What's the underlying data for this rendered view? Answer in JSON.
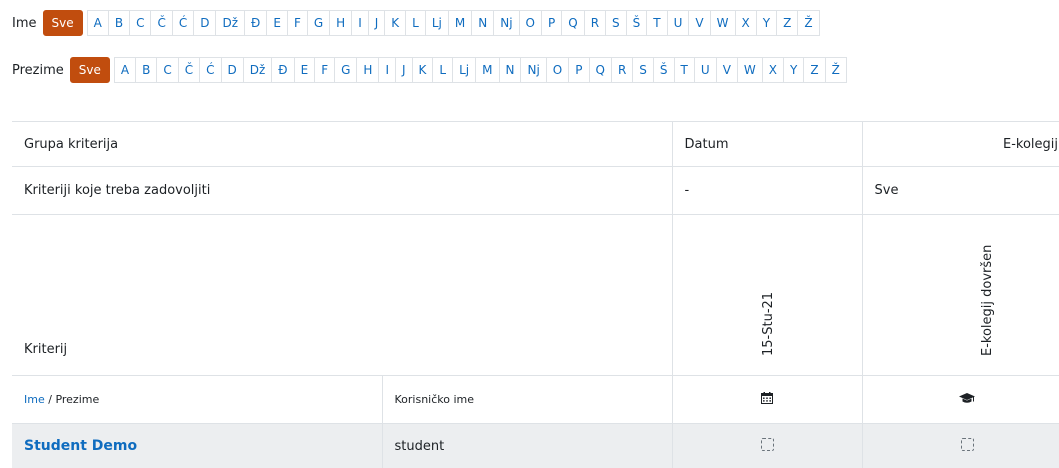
{
  "filters": {
    "first_name": {
      "title": "Ime",
      "active": "Sve",
      "letters": [
        "A",
        "B",
        "C",
        "Č",
        "Ć",
        "D",
        "Dž",
        "Đ",
        "E",
        "F",
        "G",
        "H",
        "I",
        "J",
        "K",
        "L",
        "Lj",
        "M",
        "N",
        "Nj",
        "O",
        "P",
        "Q",
        "R",
        "S",
        "Š",
        "T",
        "U",
        "V",
        "W",
        "X",
        "Y",
        "Z",
        "Ž"
      ]
    },
    "last_name": {
      "title": "Prezime",
      "active": "Sve",
      "letters": [
        "A",
        "B",
        "C",
        "Č",
        "Ć",
        "D",
        "Dž",
        "Đ",
        "E",
        "F",
        "G",
        "H",
        "I",
        "J",
        "K",
        "L",
        "Lj",
        "M",
        "N",
        "Nj",
        "O",
        "P",
        "Q",
        "R",
        "S",
        "Š",
        "T",
        "U",
        "V",
        "W",
        "X",
        "Y",
        "Z",
        "Ž"
      ]
    }
  },
  "table": {
    "criteria_group_label": "Grupa kriterija",
    "group_date": "Datum",
    "group_courses": "E-kolegij",
    "required_label": "Kriteriji koje treba zadovoljiti",
    "required_date": "-",
    "required_courses": "Sve",
    "criterion_label": "Kriterij",
    "criterion_date": "15-Stu-21",
    "criterion_course": "E-kolegij dovršen",
    "col_first_name": "Ime",
    "col_name_separator": " / ",
    "col_last_name": "Prezime",
    "col_username": "Korisničko ime",
    "date_icon": "calendar-icon",
    "course_icon": "graduation-cap-icon",
    "rows": [
      {
        "name": "Student Demo",
        "username": "student",
        "date_complete": false,
        "course_complete": false
      }
    ]
  },
  "colors": {
    "accent": "#c14d0e",
    "link": "#0f6cbf",
    "row_bg": "#eceef0"
  }
}
